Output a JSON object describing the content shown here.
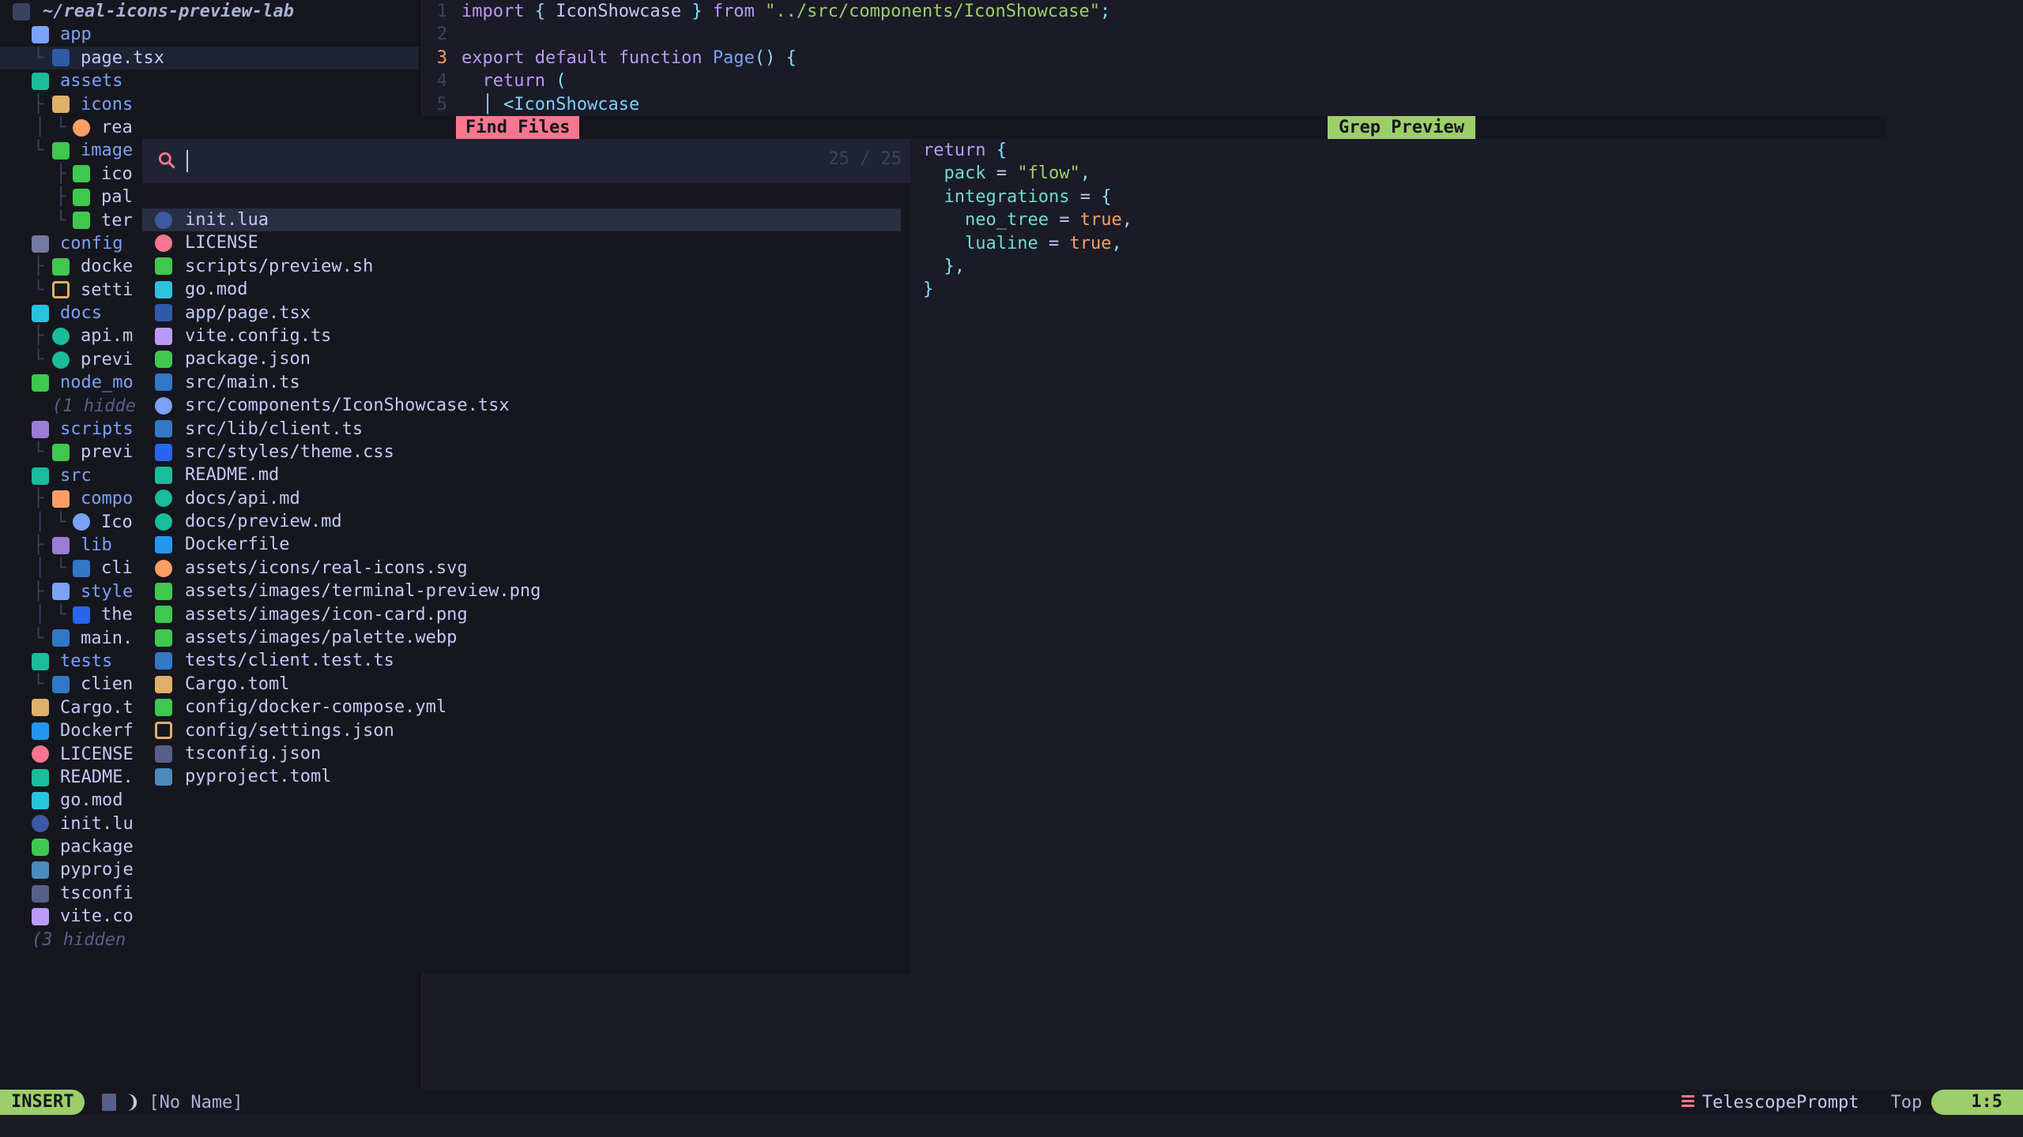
{
  "tree": {
    "root": "~/real-icons-preview-lab",
    "rows": [
      {
        "label": "app",
        "kind": "dir",
        "icon": "ic-app",
        "guide": "",
        "indent": 1
      },
      {
        "label": "page.tsx",
        "kind": "file",
        "icon": "ic-tsx",
        "guide": "└",
        "indent": 2,
        "sel": true
      },
      {
        "label": "assets",
        "kind": "dir",
        "icon": "ic-assets",
        "guide": "",
        "indent": 1
      },
      {
        "label": "icons",
        "kind": "dir",
        "icon": "ic-icons",
        "guide": "├",
        "indent": 2
      },
      {
        "label": "rea",
        "kind": "file",
        "icon": "ic-svg",
        "guide": "│ └",
        "indent": 3
      },
      {
        "label": "image",
        "kind": "dir",
        "icon": "ic-img",
        "guide": "└",
        "indent": 2
      },
      {
        "label": "ico",
        "kind": "file",
        "icon": "ic-img",
        "guide": "  ├",
        "indent": 3
      },
      {
        "label": "pal",
        "kind": "file",
        "icon": "ic-img",
        "guide": "  ├",
        "indent": 3
      },
      {
        "label": "ter",
        "kind": "file",
        "icon": "ic-img",
        "guide": "  └",
        "indent": 3
      },
      {
        "label": "config",
        "kind": "dir",
        "icon": "ic-config",
        "guide": "",
        "indent": 1
      },
      {
        "label": "docke",
        "kind": "file",
        "icon": "ic-docker",
        "guide": "├",
        "indent": 2
      },
      {
        "label": "setti",
        "kind": "file",
        "icon": "ic-json",
        "guide": "└",
        "indent": 2
      },
      {
        "label": "docs",
        "kind": "dir",
        "icon": "ic-docs",
        "guide": "",
        "indent": 1
      },
      {
        "label": "api.m",
        "kind": "file",
        "icon": "ic-md",
        "guide": "├",
        "indent": 2
      },
      {
        "label": "previ",
        "kind": "file",
        "icon": "ic-md",
        "guide": "└",
        "indent": 2
      },
      {
        "label": "node_mo",
        "kind": "dir",
        "icon": "ic-node",
        "guide": "",
        "indent": 1
      },
      {
        "label": "(1 hidde",
        "kind": "hid",
        "icon": "",
        "guide": "",
        "indent": 2
      },
      {
        "label": "scripts",
        "kind": "dir",
        "icon": "ic-scripts",
        "guide": "",
        "indent": 1
      },
      {
        "label": "previ",
        "kind": "file",
        "icon": "ic-sh",
        "guide": "└",
        "indent": 2
      },
      {
        "label": "src",
        "kind": "dir",
        "icon": "ic-src",
        "guide": "",
        "indent": 1
      },
      {
        "label": "compo",
        "kind": "dir",
        "icon": "ic-compo",
        "guide": "├",
        "indent": 2
      },
      {
        "label": "Ico",
        "kind": "file",
        "icon": "ic-react",
        "guide": "│ └",
        "indent": 3
      },
      {
        "label": "lib",
        "kind": "dir",
        "icon": "ic-lib",
        "guide": "├",
        "indent": 2
      },
      {
        "label": "cli",
        "kind": "file",
        "icon": "ic-ts",
        "guide": "│ └",
        "indent": 3
      },
      {
        "label": "style",
        "kind": "dir",
        "icon": "ic-style",
        "guide": "├",
        "indent": 2
      },
      {
        "label": "the",
        "kind": "file",
        "icon": "ic-css",
        "guide": "│ └",
        "indent": 3
      },
      {
        "label": "main.",
        "kind": "file",
        "icon": "ic-ts",
        "guide": "└",
        "indent": 2
      },
      {
        "label": "tests",
        "kind": "dir",
        "icon": "ic-tests",
        "guide": "",
        "indent": 1
      },
      {
        "label": "clien",
        "kind": "file",
        "icon": "ic-ts",
        "guide": "└",
        "indent": 2
      },
      {
        "label": "Cargo.t",
        "kind": "file",
        "icon": "ic-cargo",
        "guide": "",
        "indent": 1
      },
      {
        "label": "Dockerf",
        "kind": "file",
        "icon": "ic-dockerf",
        "guide": "",
        "indent": 1
      },
      {
        "label": "LICENSE",
        "kind": "file",
        "icon": "ic-license",
        "guide": "",
        "indent": 1
      },
      {
        "label": "README.",
        "kind": "file",
        "icon": "ic-readme",
        "guide": "",
        "indent": 1
      },
      {
        "label": "go.mod",
        "kind": "file",
        "icon": "ic-go",
        "guide": "",
        "indent": 1
      },
      {
        "label": "init.lu",
        "kind": "file",
        "icon": "ic-lua",
        "guide": "",
        "indent": 1
      },
      {
        "label": "package",
        "kind": "file",
        "icon": "ic-pkg",
        "guide": "",
        "indent": 1
      },
      {
        "label": "pyproje",
        "kind": "file",
        "icon": "ic-py",
        "guide": "",
        "indent": 1
      },
      {
        "label": "tsconfi",
        "kind": "file",
        "icon": "ic-tsconf",
        "guide": "",
        "indent": 1
      },
      {
        "label": "vite.co",
        "kind": "file",
        "icon": "ic-vite",
        "guide": "",
        "indent": 1
      },
      {
        "label": "(3 hidden",
        "kind": "hid",
        "icon": "",
        "guide": "",
        "indent": 1
      }
    ]
  },
  "editor": {
    "lines": [
      {
        "n": "1",
        "tokens": [
          [
            "kw",
            "import "
          ],
          [
            "pn",
            "{ "
          ],
          [
            "id",
            "IconShowcase "
          ],
          [
            "pn",
            "} "
          ],
          [
            "kw",
            "from "
          ],
          [
            "str",
            "\"../src/components/IconShowcase\""
          ],
          [
            "pn",
            ";"
          ]
        ]
      },
      {
        "n": "2",
        "tokens": []
      },
      {
        "n": "3",
        "cur": true,
        "tokens": [
          [
            "kw",
            "export "
          ],
          [
            "kw",
            "default "
          ],
          [
            "kw",
            "function "
          ],
          [
            "fn",
            "Page"
          ],
          [
            "pn",
            "() {"
          ]
        ]
      },
      {
        "n": "4",
        "tokens": [
          [
            "pl",
            "  "
          ],
          [
            "kw",
            "return "
          ],
          [
            "pn",
            "("
          ]
        ]
      },
      {
        "n": "5",
        "tokens": [
          [
            "pl",
            "  "
          ],
          [
            "pn",
            "│ <"
          ],
          [
            "tg",
            "IconShowcase"
          ]
        ]
      }
    ]
  },
  "telescope": {
    "prompt_title": "Find Files",
    "preview_title": "Grep Preview",
    "counter": "25 / 25",
    "query": "",
    "results": [
      {
        "path": "init.lua",
        "icon": "ic-lua",
        "sel": true
      },
      {
        "path": "LICENSE",
        "icon": "ic-license"
      },
      {
        "path": "scripts/preview.sh",
        "icon": "ic-sh"
      },
      {
        "path": "go.mod",
        "icon": "ic-go"
      },
      {
        "path": "app/page.tsx",
        "icon": "ic-tsx"
      },
      {
        "path": "vite.config.ts",
        "icon": "ic-vite"
      },
      {
        "path": "package.json",
        "icon": "ic-pkg"
      },
      {
        "path": "src/main.ts",
        "icon": "ic-ts"
      },
      {
        "path": "src/components/IconShowcase.tsx",
        "icon": "ic-react"
      },
      {
        "path": "src/lib/client.ts",
        "icon": "ic-ts"
      },
      {
        "path": "src/styles/theme.css",
        "icon": "ic-css"
      },
      {
        "path": "README.md",
        "icon": "ic-readme"
      },
      {
        "path": "docs/api.md",
        "icon": "ic-md"
      },
      {
        "path": "docs/preview.md",
        "icon": "ic-md"
      },
      {
        "path": "Dockerfile",
        "icon": "ic-dockerf"
      },
      {
        "path": "assets/icons/real-icons.svg",
        "icon": "ic-svg"
      },
      {
        "path": "assets/images/terminal-preview.png",
        "icon": "ic-img"
      },
      {
        "path": "assets/images/icon-card.png",
        "icon": "ic-img"
      },
      {
        "path": "assets/images/palette.webp",
        "icon": "ic-img"
      },
      {
        "path": "tests/client.test.ts",
        "icon": "ic-ts"
      },
      {
        "path": "Cargo.toml",
        "icon": "ic-cargo"
      },
      {
        "path": "config/docker-compose.yml",
        "icon": "ic-docker"
      },
      {
        "path": "config/settings.json",
        "icon": "ic-json"
      },
      {
        "path": "tsconfig.json",
        "icon": "ic-tsconf"
      },
      {
        "path": "pyproject.toml",
        "icon": "ic-py"
      }
    ],
    "preview_lines": [
      [
        [
          "kw",
          "return "
        ],
        [
          "pn",
          "{"
        ]
      ],
      [
        [
          "pl",
          "  "
        ],
        [
          "key",
          "pack"
        ],
        [
          "pl",
          " = "
        ],
        [
          "str",
          "\"flow\""
        ],
        [
          "pn",
          ","
        ]
      ],
      [
        [
          "pl",
          "  "
        ],
        [
          "key",
          "integrations"
        ],
        [
          "pl",
          " = "
        ],
        [
          "pn",
          "{"
        ]
      ],
      [
        [
          "pl",
          "    "
        ],
        [
          "key",
          "neo_tree"
        ],
        [
          "pl",
          " = "
        ],
        [
          "bool",
          "true"
        ],
        [
          "pn",
          ","
        ]
      ],
      [
        [
          "pl",
          "    "
        ],
        [
          "key",
          "lualine"
        ],
        [
          "pl",
          " = "
        ],
        [
          "bool",
          "true"
        ],
        [
          "pn",
          ","
        ]
      ],
      [
        [
          "pl",
          "  "
        ],
        [
          "pn",
          "},"
        ]
      ],
      [
        [
          "pn",
          "}"
        ]
      ]
    ]
  },
  "status": {
    "mode": "INSERT",
    "buffer": "[No Name]",
    "filetype": "TelescopePrompt",
    "scroll": "Top",
    "position": "1:5"
  }
}
